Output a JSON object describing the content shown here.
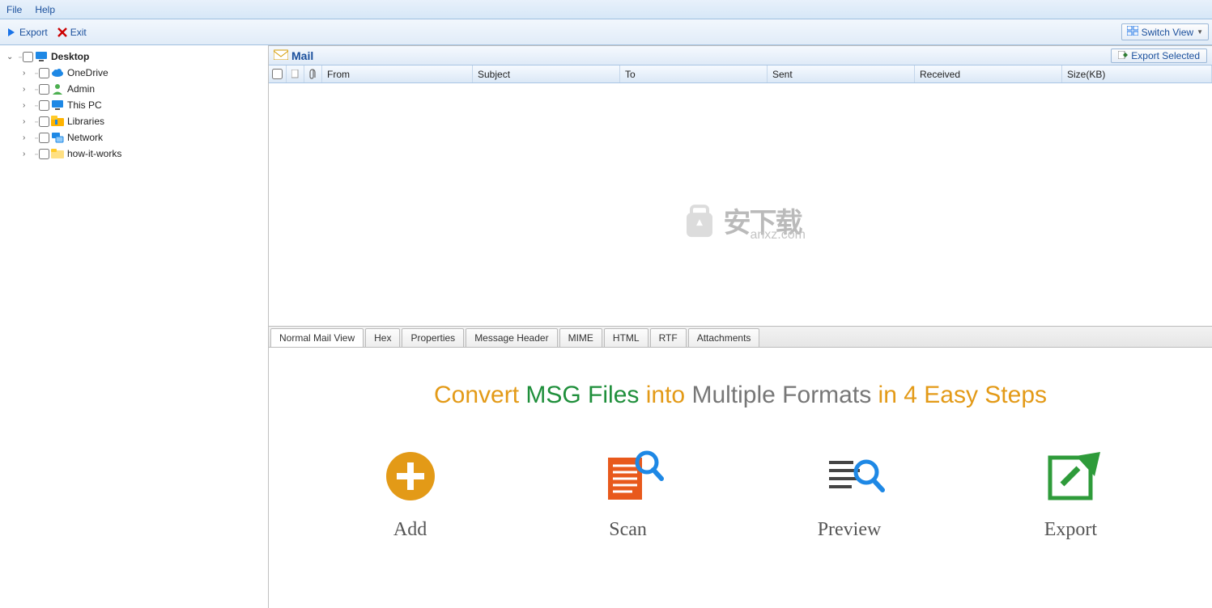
{
  "menu": {
    "file": "File",
    "help": "Help"
  },
  "toolbar": {
    "export": "Export",
    "exit": "Exit",
    "switch_view": "Switch View"
  },
  "tree": {
    "root": {
      "label": "Desktop"
    },
    "children": [
      {
        "label": "OneDrive"
      },
      {
        "label": "Admin"
      },
      {
        "label": "This PC"
      },
      {
        "label": "Libraries"
      },
      {
        "label": "Network"
      },
      {
        "label": "how-it-works"
      }
    ]
  },
  "mail": {
    "title": "Mail",
    "export_selected": "Export Selected",
    "columns": {
      "from": "From",
      "subject": "Subject",
      "to": "To",
      "sent": "Sent",
      "received": "Received",
      "size": "Size(KB)"
    }
  },
  "watermark": {
    "text": "安下载",
    "domain": "anxz.com"
  },
  "tabs": [
    "Normal Mail View",
    "Hex",
    "Properties",
    "Message Header",
    "MIME",
    "HTML",
    "RTF",
    "Attachments"
  ],
  "promo": {
    "heading": {
      "p1": "Convert",
      "p2": "MSG Files",
      "p3": "into",
      "p4": "Multiple Formats",
      "p5": "in",
      "p6": "4 Easy Steps"
    },
    "steps": {
      "add": "Add",
      "scan": "Scan",
      "preview": "Preview",
      "export": "Export"
    }
  }
}
